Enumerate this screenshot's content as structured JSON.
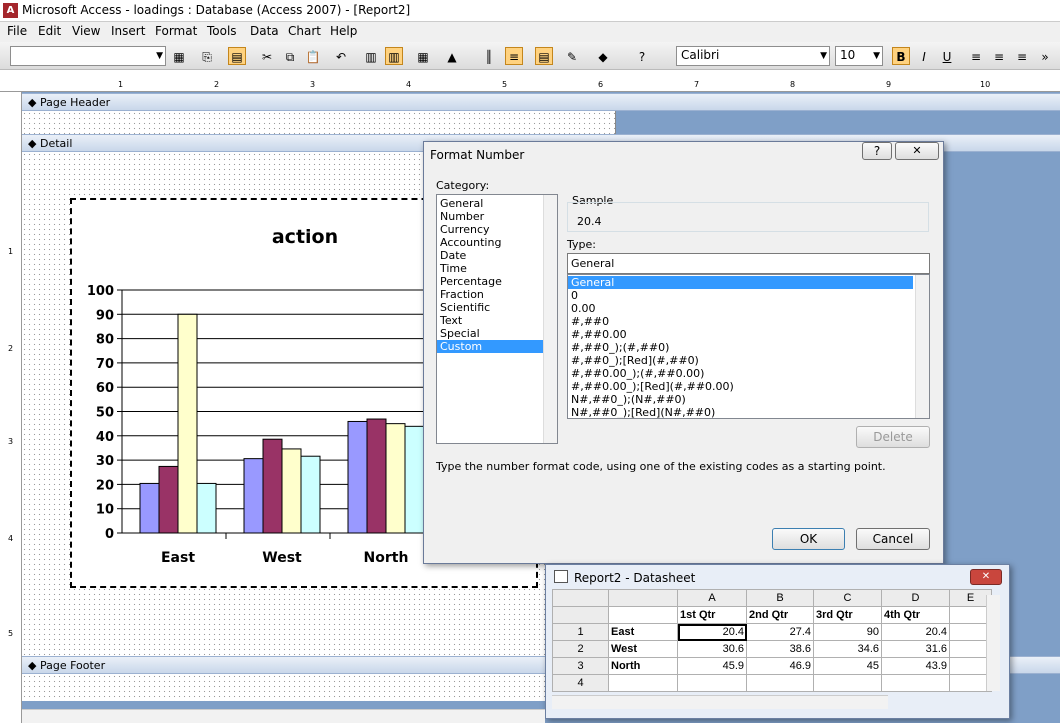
{
  "app": {
    "title": "Microsoft Access - loadings : Database (Access 2007) - [Report2]"
  },
  "menu": [
    "File",
    "Edit",
    "View",
    "Insert",
    "Format",
    "Tools",
    "Data",
    "Chart",
    "Help"
  ],
  "toolbar": {
    "font": "Calibri",
    "size": "10",
    "bold": "B",
    "italic": "I",
    "underline": "U"
  },
  "ruler": [
    "1",
    "2",
    "3",
    "4",
    "5",
    "6",
    "7",
    "8",
    "9",
    "10"
  ],
  "vruler": [
    "1",
    "2",
    "3",
    "4",
    "5"
  ],
  "bands": {
    "page_header": "Page Header",
    "detail": "Detail",
    "page_footer": "Page Footer"
  },
  "chart_data": {
    "type": "bar",
    "title": "action",
    "categories": [
      "East",
      "West",
      "North"
    ],
    "series": [
      {
        "values": [
          20.4,
          30.6,
          45.9
        ],
        "color": "#9999ff"
      },
      {
        "values": [
          27.4,
          38.6,
          46.9
        ],
        "color": "#993366"
      },
      {
        "values": [
          90,
          34.6,
          45
        ],
        "color": "#ffffcc"
      },
      {
        "values": [
          20.4,
          31.6,
          43.9
        ],
        "color": "#ccffff"
      }
    ],
    "yticks": [
      "0",
      "10",
      "20",
      "30",
      "40",
      "50",
      "60",
      "70",
      "80",
      "90",
      "100"
    ],
    "ylim": [
      0,
      100
    ],
    "grid": true
  },
  "dialog": {
    "title": "Format Number",
    "help": "?",
    "close": "✕",
    "category_label": "Category:",
    "categories": [
      "General",
      "Number",
      "Currency",
      "Accounting",
      "Date",
      "Time",
      "Percentage",
      "Fraction",
      "Scientific",
      "Text",
      "Special",
      "Custom"
    ],
    "selected_category": "Custom",
    "sample_label": "Sample",
    "sample_value": "20.4",
    "type_label": "Type:",
    "type_value": "General",
    "types": [
      "General",
      "0",
      "0.00",
      "#,##0",
      "#,##0.00",
      "#,##0_);(#,##0)",
      "#,##0_);[Red](#,##0)",
      "#,##0.00_);(#,##0.00)",
      "#,##0.00_);[Red](#,##0.00)",
      "N#,##0_);(N#,##0)",
      "N#,##0_);[Red](N#,##0)"
    ],
    "selected_type": "General",
    "delete": "Delete",
    "hint": "Type the number format code, using one of the existing codes as a starting point.",
    "ok": "OK",
    "cancel": "Cancel"
  },
  "datasheet": {
    "title": "Report2 - Datasheet",
    "close": "✕",
    "col_letters": [
      "A",
      "B",
      "C",
      "D",
      "E"
    ],
    "headers": [
      "1st Qtr",
      "2nd Qtr",
      "3rd Qtr",
      "4th Qtr"
    ],
    "rows": [
      {
        "num": "1",
        "label": "East",
        "values": [
          "20.4",
          "27.4",
          "90",
          "20.4"
        ]
      },
      {
        "num": "2",
        "label": "West",
        "values": [
          "30.6",
          "38.6",
          "34.6",
          "31.6"
        ]
      },
      {
        "num": "3",
        "label": "North",
        "values": [
          "45.9",
          "46.9",
          "45",
          "43.9"
        ]
      },
      {
        "num": "4",
        "label": "",
        "values": [
          "",
          "",
          "",
          ""
        ]
      }
    ]
  }
}
